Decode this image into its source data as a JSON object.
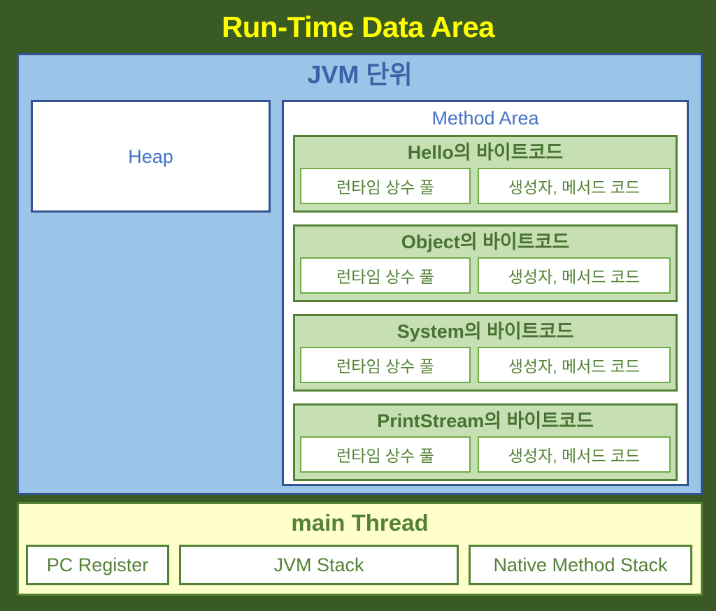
{
  "diagram": {
    "title": "Run-Time Data Area",
    "jvm_unit": {
      "title": "JVM 단위",
      "heap": {
        "label": "Heap"
      },
      "method_area": {
        "title": "Method Area",
        "bytecode_blocks": [
          {
            "title": "Hello의 바이트코드",
            "runtime_constant_pool": "런타임 상수 풀",
            "constructor_method_code": "생성자, 메서드 코드"
          },
          {
            "title": "Object의 바이트코드",
            "runtime_constant_pool": "런타임 상수 풀",
            "constructor_method_code": "생성자, 메서드 코드"
          },
          {
            "title": "System의 바이트코드",
            "runtime_constant_pool": "런타임 상수 풀",
            "constructor_method_code": "생성자, 메서드 코드"
          },
          {
            "title": "PrintStream의 바이트코드",
            "runtime_constant_pool": "런타임 상수 풀",
            "constructor_method_code": "생성자, 메서드 코드"
          }
        ]
      }
    },
    "main_thread": {
      "title": "main Thread",
      "boxes": [
        {
          "label": "PC Register"
        },
        {
          "label": "JVM Stack"
        },
        {
          "label": "Native Method Stack"
        }
      ]
    }
  },
  "colors": {
    "canvas_green": "#3a5a23",
    "title_yellow": "#ffff00",
    "jvm_blue_fill": "#9cc3e8",
    "jvm_blue_border": "#31538f",
    "heap_text_blue": "#4472c4",
    "bytecode_fill": "#c6e0b4",
    "bytecode_border": "#548235",
    "bytecode_text": "#477231",
    "subbox_border": "#70ad47",
    "thread_fill": "#ffffcc",
    "thread_text": "#538135"
  }
}
